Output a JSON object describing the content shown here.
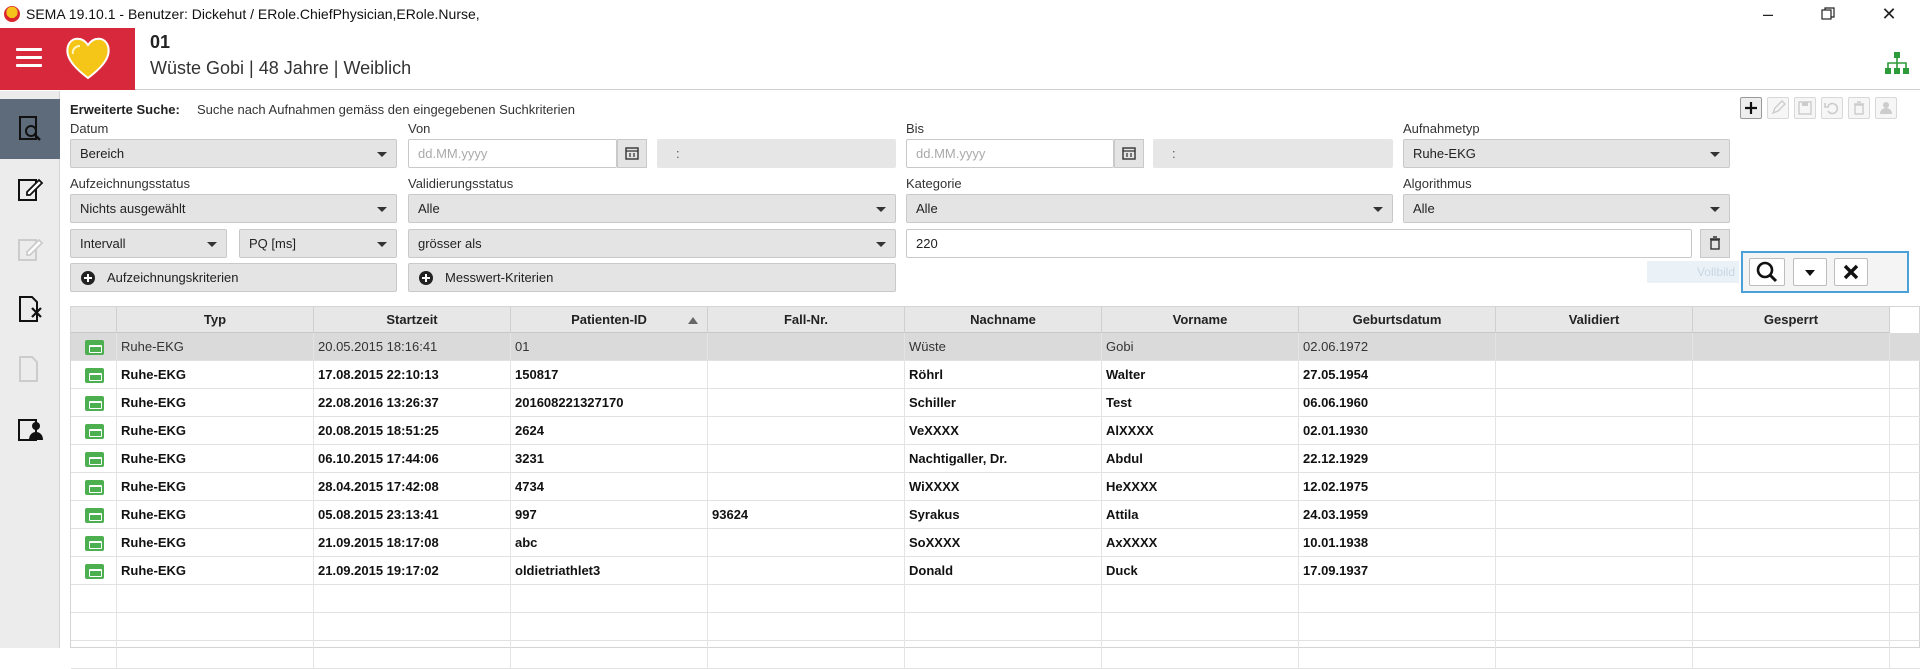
{
  "window": {
    "title": "SEMA 19.10.1 - Benutzer: Dickehut / ERole.ChiefPhysician,ERole.Nurse,"
  },
  "patient": {
    "id": "01",
    "info": "Wüste Gobi | 48 Jahre | Weiblich"
  },
  "search": {
    "section_label": "Erweiterte Suche:",
    "section_desc": "Suche nach Aufnahmen gemäss den eingegebenen Suchkriterien",
    "datum_label": "Datum",
    "datum_value": "Bereich",
    "von_label": "Von",
    "von_placeholder": "dd.MM.yyyy",
    "von_time": ":",
    "bis_label": "Bis",
    "bis_placeholder": "dd.MM.yyyy",
    "bis_time": ":",
    "aufnahmetyp_label": "Aufnahmetyp",
    "aufnahmetyp_value": "Ruhe-EKG",
    "aufzeichnungsstatus_label": "Aufzeichnungsstatus",
    "aufzeichnungsstatus_value": "Nichts ausgewählt",
    "validierungsstatus_label": "Validierungsstatus",
    "validierungsstatus_value": "Alle",
    "kategorie_label": "Kategorie",
    "kategorie_value": "Alle",
    "algorithmus_label": "Algorithmus",
    "algorithmus_value": "Alle",
    "intervall_value": "Intervall",
    "messwert_value": "PQ [ms]",
    "operator_value": "grösser als",
    "criteria_value": "220",
    "aufzeichnungskriterien_label": "Aufzeichnungskriterien",
    "messwertkriterien_label": "Messwert-Kriterien",
    "vollbild_label": "Vollbild"
  },
  "table": {
    "columns": [
      "",
      "Typ",
      "Startzeit",
      "Patienten-ID",
      "Fall-Nr.",
      "Nachname",
      "Vorname",
      "Geburtsdatum",
      "Validiert",
      "Gesperrt"
    ],
    "rows": [
      [
        "",
        "Ruhe-EKG",
        "20.05.2015 18:16:41",
        "01",
        "",
        "Wüste",
        "Gobi",
        "02.06.1972",
        "",
        ""
      ],
      [
        "",
        "Ruhe-EKG",
        "17.08.2015 22:10:13",
        "150817",
        "",
        "Röhrl",
        "Walter",
        "27.05.1954",
        "",
        ""
      ],
      [
        "",
        "Ruhe-EKG",
        "22.08.2016 13:26:37",
        "201608221327170",
        "",
        "Schiller",
        "Test",
        "06.06.1960",
        "",
        ""
      ],
      [
        "",
        "Ruhe-EKG",
        "20.08.2015 18:51:25",
        "2624",
        "",
        "VeXXXX",
        "AlXXXX",
        "02.01.1930",
        "",
        ""
      ],
      [
        "",
        "Ruhe-EKG",
        "06.10.2015 17:44:06",
        "3231",
        "",
        "Nachtigaller, Dr.",
        "Abdul",
        "22.12.1929",
        "",
        ""
      ],
      [
        "",
        "Ruhe-EKG",
        "28.04.2015 17:42:08",
        "4734",
        "",
        "WiXXXX",
        "HeXXXX",
        "12.02.1975",
        "",
        ""
      ],
      [
        "",
        "Ruhe-EKG",
        "05.08.2015 23:13:41",
        "997",
        "93624",
        "Syrakus",
        "Attila",
        "24.03.1959",
        "",
        ""
      ],
      [
        "",
        "Ruhe-EKG",
        "21.09.2015 18:17:08",
        "abc",
        "",
        "SoXXXX",
        "AxXXXX",
        "10.01.1938",
        "",
        ""
      ],
      [
        "",
        "Ruhe-EKG",
        "21.09.2015 19:17:02",
        "oldietriathlet3",
        "",
        "Donald",
        "Duck",
        "17.09.1937",
        "",
        ""
      ]
    ],
    "sort_column": "Patienten-ID",
    "sort_direction": "ascending",
    "selected_row": 0
  },
  "icons": {
    "app": "sema-heart-icon",
    "menu": "hamburger-icon",
    "logo": "heart-logo",
    "hierarchy": "hierarchy-icon",
    "nav": [
      "search-recordings-icon",
      "edit-document-icon",
      "document-disabled-icon",
      "delete-document-icon",
      "document-disabled-icon",
      "patient-document-icon"
    ],
    "row": "bed-icon"
  },
  "colors": {
    "brand_red": "#d8283b",
    "heart_yellow": "#f5c518",
    "nav_active": "#5d6b7a",
    "row_icon_green": "#4caf50",
    "focus_blue": "#4ba0d8"
  }
}
